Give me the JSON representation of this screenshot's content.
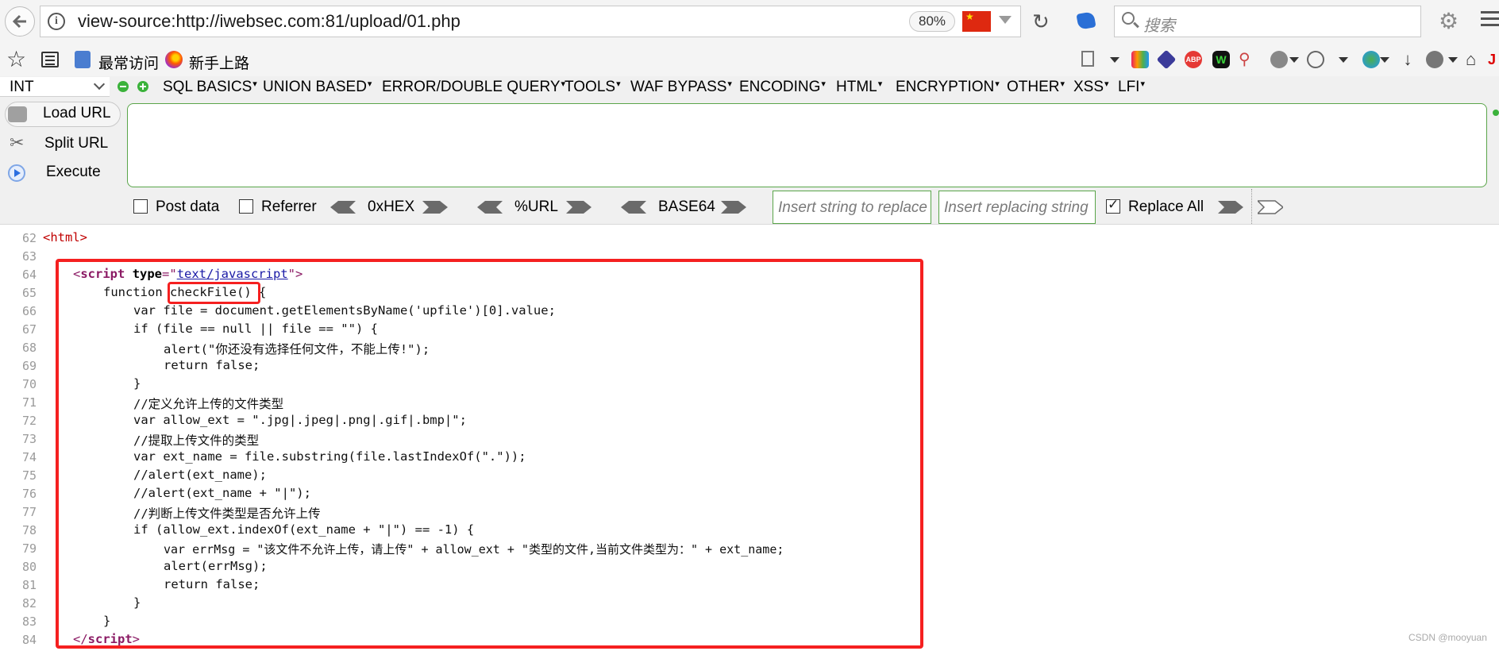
{
  "browser": {
    "url": "view-source:http://iwebsec.com:81/upload/01.php",
    "zoom": "80%",
    "search_placeholder": "搜索"
  },
  "bookmarks": [
    {
      "label": "最常访问"
    },
    {
      "label": "新手上路"
    }
  ],
  "hackbar": {
    "select_value": "INT",
    "menus": [
      "SQL BASICS",
      "UNION BASED",
      "ERROR/DOUBLE QUERY",
      "TOOLS",
      "WAF BYPASS",
      "ENCODING",
      "HTML",
      "ENCRYPTION",
      "OTHER",
      "XSS",
      "LFI"
    ],
    "buttons": {
      "load": "Load URL",
      "split": "Split URL",
      "execute": "Execute"
    },
    "textarea_value": "",
    "options": {
      "post_data": "Post data",
      "referrer": "Referrer",
      "hex": "0xHEX",
      "url": "%URL",
      "base64": "BASE64",
      "replace_placeholder": "Insert string to replace",
      "replacing_placeholder": "Insert replacing string",
      "replace_all": "Replace All"
    },
    "replace_all_checked": true
  },
  "source": {
    "line_numbers": [
      "62",
      "63",
      "64",
      "65",
      "66",
      "67",
      "68",
      "69",
      "70",
      "71",
      "72",
      "73",
      "74",
      "75",
      "76",
      "77",
      "78",
      "79",
      "80",
      "81",
      "82",
      "83",
      "84"
    ],
    "lines": {
      "l66": "var file = document.getElementsByName('upfile')[0].value;",
      "l67": "if (file == null || file == \"\") {",
      "l68": "alert(\"你还没有选择任何文件，不能上传!\");",
      "l69": "return false;",
      "l70": "}",
      "l71": "//定义允许上传的文件类型",
      "l72": "var allow_ext = \".jpg|.jpeg|.png|.gif|.bmp|\";",
      "l73": "//提取上传文件的类型",
      "l74": "var ext_name = file.substring(file.lastIndexOf(\".\"));",
      "l75": "//alert(ext_name);",
      "l76": "//alert(ext_name + \"|\");",
      "l77": "//判断上传文件类型是否允许上传",
      "l78": "if (allow_ext.indexOf(ext_name + \"|\") == -1) {",
      "l79": "var errMsg = \"该文件不允许上传，请上传\" + allow_ext + \"类型的文件,当前文件类型为：\" + ext_name;",
      "l80": "alert(errMsg);",
      "l81": "return false;",
      "l82": "}",
      "l83": "}"
    },
    "tokens": {
      "lt": "<",
      "gt": ">",
      "html_tag": "<html>",
      "script_tag": "script",
      "type_attr": "type",
      "eq_quote": "=\"",
      "type_value": "text/javascript",
      "close_quote_gt": "\">",
      "function_kw": "function ",
      "function_name": "checkFile()",
      "open_brace": " {",
      "close_script_open": "</",
      "close_script_end": ">"
    }
  },
  "watermark": "CSDN @mooyuan",
  "colors": {
    "highlight_red": "#f52020",
    "input_border": "#5aa54a"
  }
}
